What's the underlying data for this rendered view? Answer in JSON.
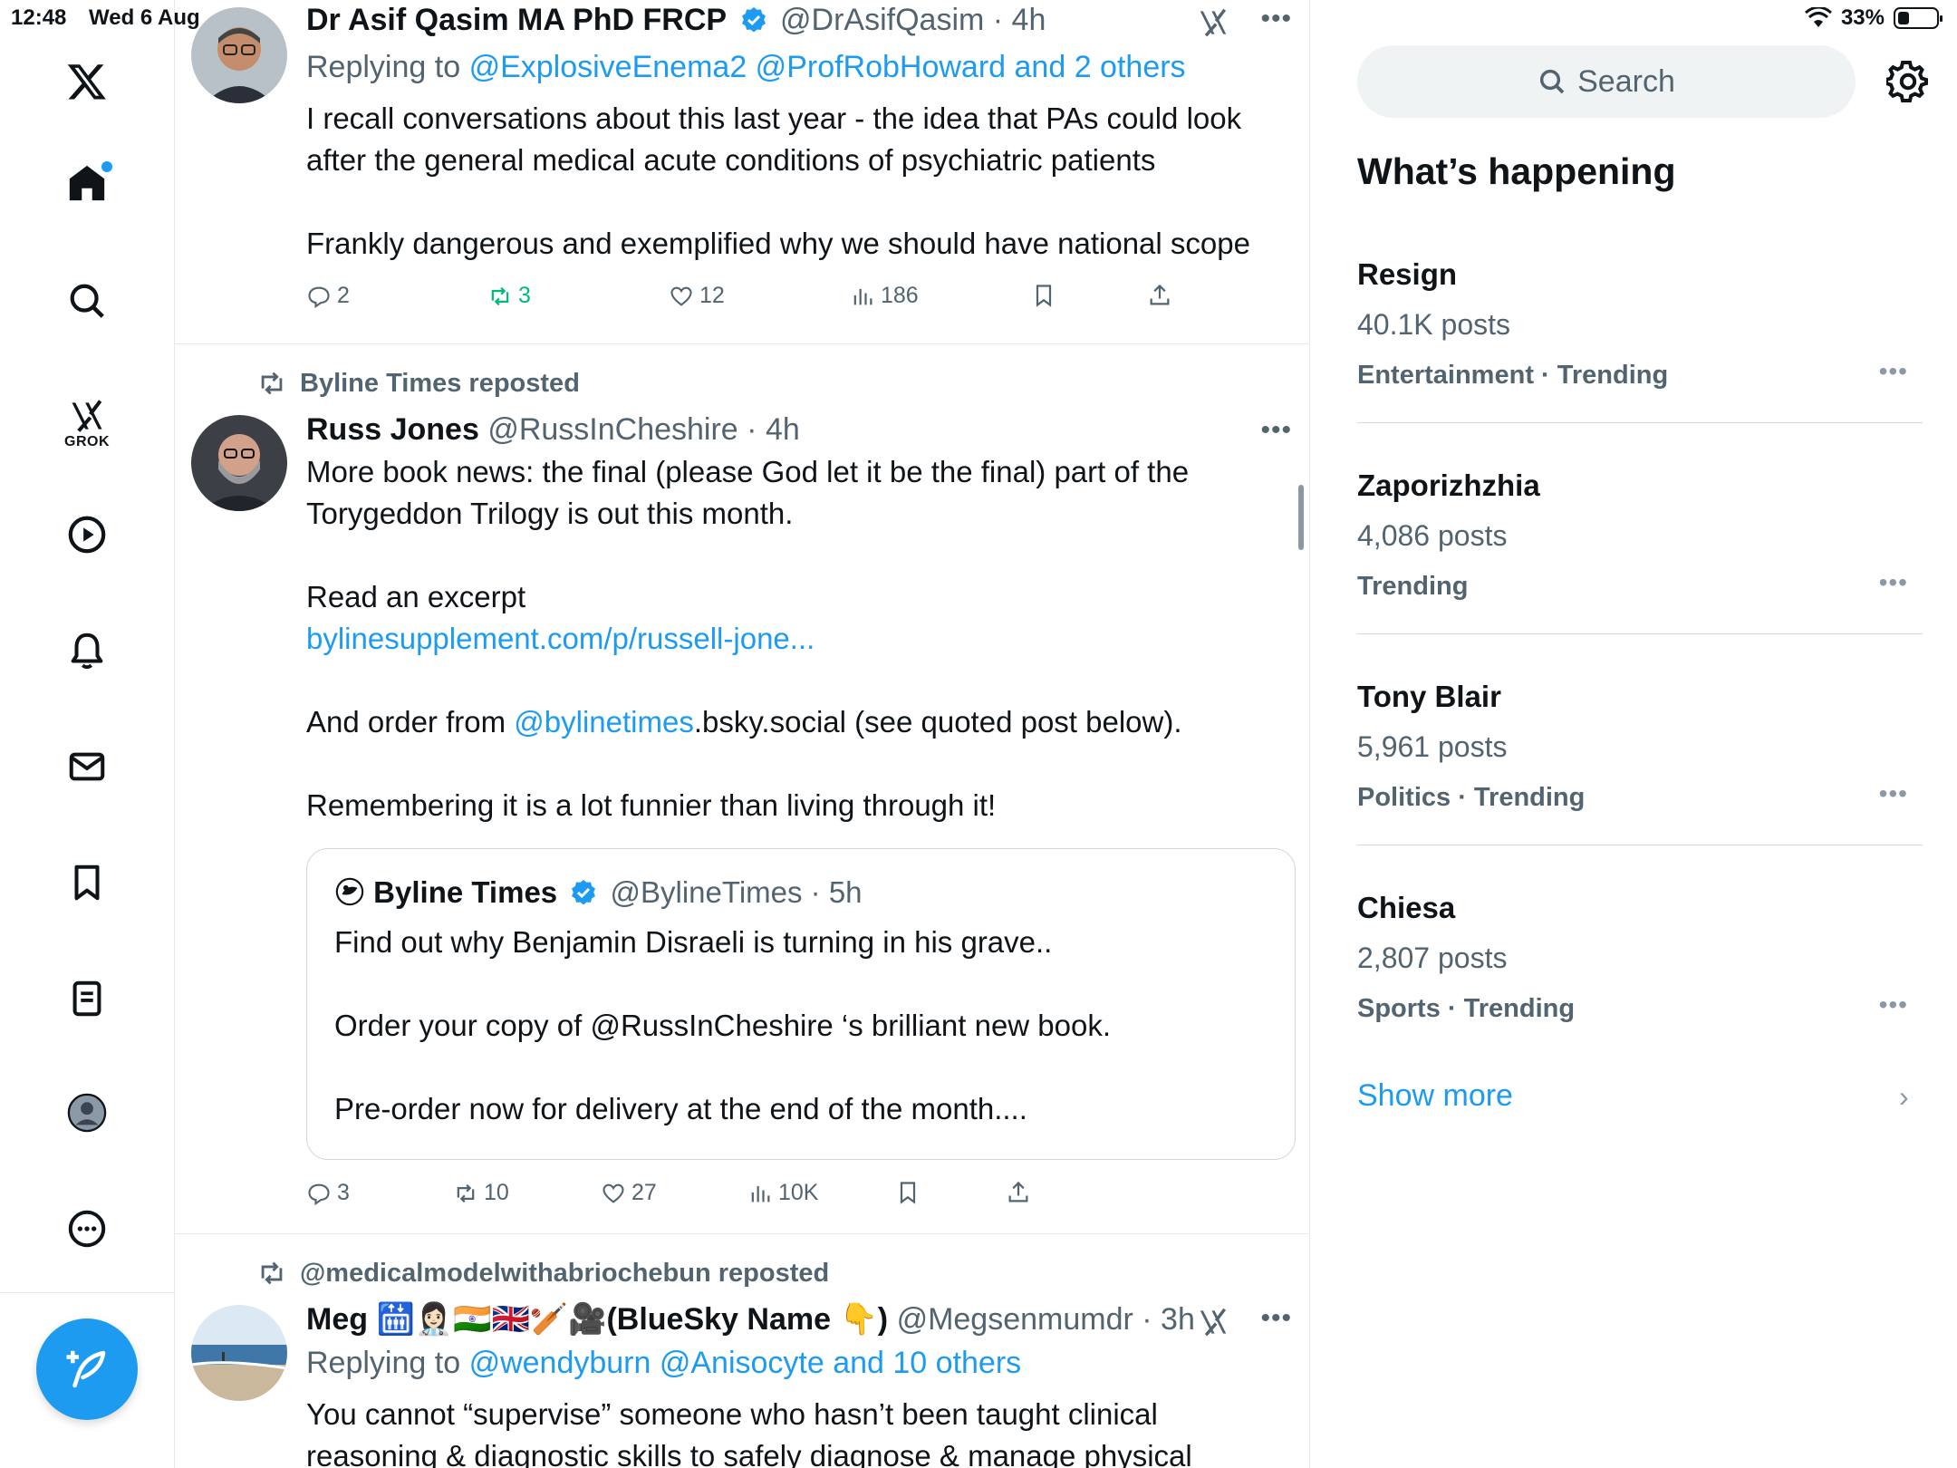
{
  "status_bar": {
    "time": "12:48",
    "date": "Wed 6 Aug",
    "battery": "33%"
  },
  "nav": {
    "grok_label": "GROK",
    "items": [
      "home",
      "explore",
      "grok",
      "videos",
      "notifications",
      "messages",
      "bookmarks",
      "lists",
      "profile",
      "more"
    ]
  },
  "posts": [
    {
      "author_name": "Dr Asif Qasim MA PhD FRCP",
      "handle": "@DrAsifQasim",
      "time": "· 4h",
      "replying_label": "Replying to",
      "replying_to": "@ExplosiveEnema2 @ProfRobHoward and 2 others",
      "para1": "I recall conversations about this last year - the idea that PAs could look after the general medical acute conditions of psychiatric patients",
      "para2": "Frankly dangerous and exemplified why we should have national scope",
      "replies": "2",
      "reposts": "3",
      "likes": "12",
      "views": "186"
    },
    {
      "repost_by": "Byline Times reposted",
      "author_name": "Russ Jones",
      "handle": "@RussInCheshire",
      "time": "· 4h",
      "para1": "More book news: the final (please God let it be the final) part of the Torygeddon Trilogy is out this month.",
      "para2_line1": "Read an excerpt",
      "para2_link": "bylinesupplement.com/p/russell-jone...",
      "para3_prefix": "And order from ",
      "para3_link": "@bylinetimes",
      "para3_suffix": ".bsky.social  (see quoted post below).",
      "para4": "Remembering it is a lot funnier than living through it!",
      "quote": {
        "author_name": "Byline Times",
        "handle": "@BylineTimes",
        "time": "· 5h",
        "para1": "Find out why Benjamin Disraeli is turning in his grave..",
        "para2": "Order your copy of @RussInCheshire ‘s brilliant new book.",
        "para3": "Pre-order now for delivery at the end of the month...."
      },
      "replies": "3",
      "reposts": "10",
      "likes": "27",
      "views": "10K"
    },
    {
      "repost_by": "@medicalmodelwithabriochebun reposted",
      "author_name": "Meg 🛗👩🏻‍⚕️🇮🇳🇬🇧🏏🎥(BlueSky Name 👇)",
      "handle": "@Megsenmumdr",
      "time": "· 3h",
      "replying_label": "Replying to",
      "replying_to": "@wendyburn @Anisocyte and 10 others",
      "para1": "You cannot “supervise” someone who hasn’t been taught clinical reasoning & diagnostic skills to safely diagnose & manage physical"
    }
  ],
  "sidebar": {
    "search_placeholder": "Search",
    "title": "What’s happening",
    "trends": [
      {
        "name": "Resign",
        "posts": "40.1K posts",
        "category": "Entertainment · Trending"
      },
      {
        "name": "Zaporizhzhia",
        "posts": "4,086 posts",
        "category": "Trending"
      },
      {
        "name": "Tony Blair",
        "posts": "5,961 posts",
        "category": "Politics · Trending"
      },
      {
        "name": "Chiesa",
        "posts": "2,807 posts",
        "category": "Sports · Trending"
      }
    ],
    "show_more": "Show more"
  },
  "colors": {
    "accent": "#1d9bf0",
    "muted": "#536471",
    "repost_green": "#00ba7c"
  }
}
